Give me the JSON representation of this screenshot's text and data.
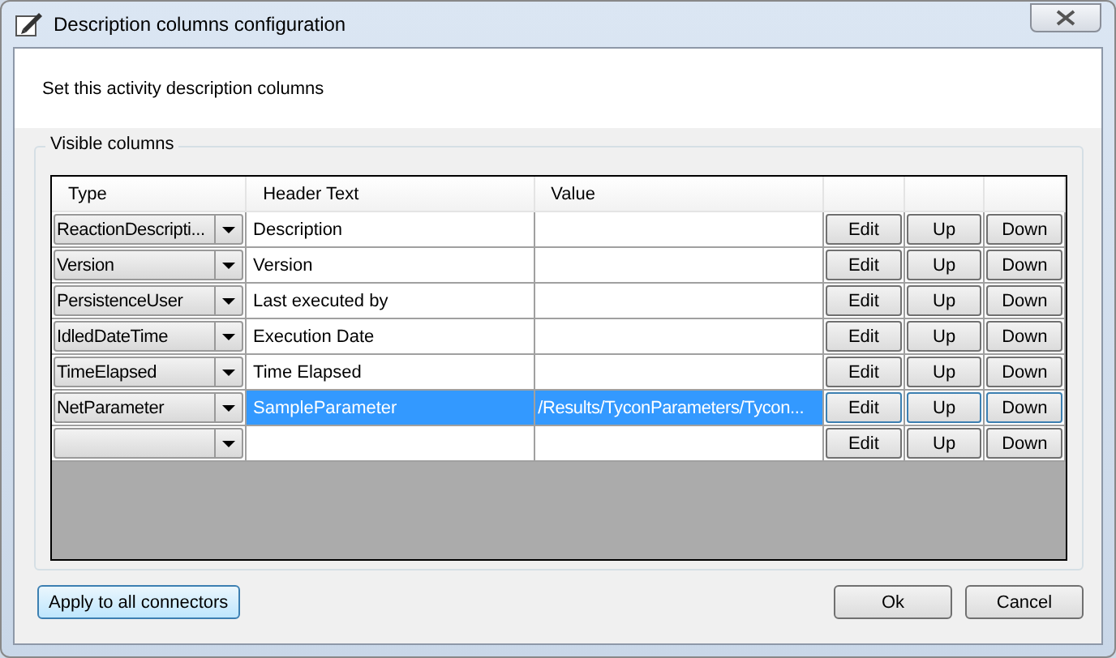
{
  "window": {
    "title": "Description columns configuration"
  },
  "instruction": "Set this activity description columns",
  "group": {
    "title": "Visible columns"
  },
  "table": {
    "columns": [
      "Type",
      "Header Text",
      "Value"
    ],
    "rows": [
      {
        "type": "ReactionDescripti...",
        "header_text": "Description",
        "selected": false,
        "buttons": [
          "Edit",
          "Up",
          "Down"
        ]
      },
      {
        "type": "Version",
        "header_text": "Version",
        "selected": false,
        "buttons": [
          "Edit",
          "Up",
          "Down"
        ]
      },
      {
        "type": "PersistenceUser",
        "header_text": "Last executed by",
        "selected": false,
        "buttons": [
          "Edit",
          "Up",
          "Down"
        ]
      },
      {
        "type": "IdledDateTime",
        "header_text": "Execution Date",
        "selected": false,
        "buttons": [
          "Edit",
          "Up",
          "Down"
        ]
      },
      {
        "type": "TimeElapsed",
        "header_text": "Time Elapsed",
        "selected": false,
        "buttons": [
          "Edit",
          "Up",
          "Down"
        ]
      },
      {
        "type": "NetParameter",
        "header_text": "SampleParameter",
        "value": "/Results/TyconParameters/Tycon...",
        "selected": true,
        "buttons": [
          "Edit",
          "Up",
          "Down"
        ]
      },
      {
        "selected": false,
        "buttons": [
          "Edit",
          "Up",
          "Down"
        ]
      }
    ]
  },
  "buttons": {
    "apply": "Apply to all connectors",
    "ok": "Ok",
    "cancel": "Cancel"
  }
}
